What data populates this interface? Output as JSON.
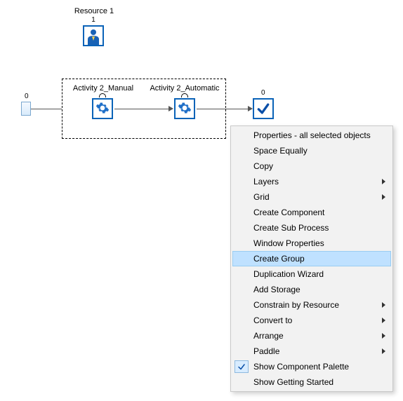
{
  "resource": {
    "label": "Resource 1",
    "count": "1"
  },
  "entry": {
    "count": "0"
  },
  "activities": [
    {
      "label": "Activity 2_Manual"
    },
    {
      "label": "Activity 2_Automatic"
    }
  ],
  "endpoint": {
    "count": "0"
  },
  "menu": {
    "items": [
      {
        "label": "Properties - all selected objects",
        "submenu": false
      },
      {
        "label": "Space Equally",
        "submenu": false
      },
      {
        "label": "Copy",
        "submenu": false
      },
      {
        "label": "Layers",
        "submenu": true
      },
      {
        "label": "Grid",
        "submenu": true
      },
      {
        "label": "Create Component",
        "submenu": false
      },
      {
        "label": "Create Sub Process",
        "submenu": false
      },
      {
        "label": "Window Properties",
        "submenu": false
      },
      {
        "label": "Create Group",
        "submenu": false,
        "highlight": true
      },
      {
        "label": "Duplication Wizard",
        "submenu": false
      },
      {
        "label": "Add Storage",
        "submenu": false
      },
      {
        "label": "Constrain by Resource",
        "submenu": true
      },
      {
        "label": "Convert to",
        "submenu": true
      },
      {
        "label": "Arrange",
        "submenu": true
      },
      {
        "label": "Paddle",
        "submenu": true
      },
      {
        "label": "Show Component Palette",
        "submenu": false,
        "checked": true
      },
      {
        "label": "Show Getting Started",
        "submenu": false
      }
    ]
  }
}
